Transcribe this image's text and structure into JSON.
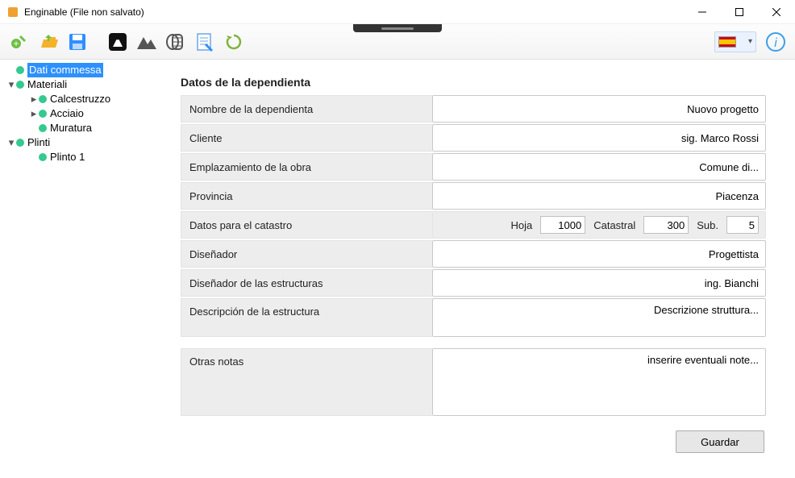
{
  "window": {
    "title": "Enginable (File non salvato)"
  },
  "toolbar": {
    "icons": [
      "new-icon",
      "open-icon",
      "save-icon",
      "weight-icon",
      "terrain-icon",
      "tape-icon",
      "notes-icon",
      "refresh-icon"
    ],
    "language": "es"
  },
  "tree": {
    "items": [
      {
        "level": 1,
        "caret": "",
        "selected": true,
        "label": "Dati commessa"
      },
      {
        "level": 1,
        "caret": "▾",
        "selected": false,
        "label": "Materiali"
      },
      {
        "level": 2,
        "caret": "▸",
        "selected": false,
        "label": "Calcestruzzo"
      },
      {
        "level": 2,
        "caret": "▸",
        "selected": false,
        "label": "Acciaio"
      },
      {
        "level": 2,
        "caret": "",
        "selected": false,
        "label": "Muratura"
      },
      {
        "level": 1,
        "caret": "▾",
        "selected": false,
        "label": "Plinti"
      },
      {
        "level": 2,
        "caret": "",
        "selected": false,
        "label": "Plinto 1"
      }
    ]
  },
  "form": {
    "section_title": "Datos de la dependienta",
    "labels": {
      "nombre": "Nombre de la dependienta",
      "cliente": "Cliente",
      "emplazamiento": "Emplazamiento de la obra",
      "provincia": "Provincia",
      "catastro": "Datos para el catastro",
      "hoja": "Hoja",
      "catastral": "Catastral",
      "sub": "Sub.",
      "disenador": "Diseñador",
      "disenador_estr": "Diseñador de las estructuras",
      "descripcion": "Descripción de la estructura",
      "otras": "Otras notas"
    },
    "values": {
      "nombre": "Nuovo progetto",
      "cliente": "sig. Marco Rossi",
      "emplazamiento": "Comune di...",
      "provincia": "Piacenza",
      "hoja": "1000",
      "catastral": "300",
      "sub": "5",
      "disenador": "Progettista",
      "disenador_estr": "ing. Bianchi",
      "descripcion": "Descrizione struttura...",
      "otras": "inserire eventuali note..."
    },
    "save": "Guardar"
  }
}
